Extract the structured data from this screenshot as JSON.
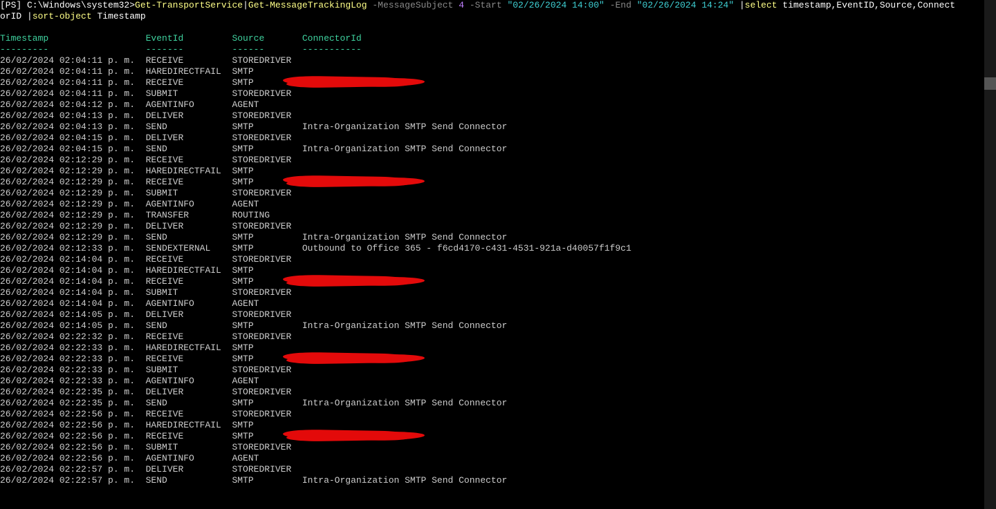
{
  "prompt": {
    "ps_label": "[PS]",
    "path": "C:\\Windows\\system32>",
    "cmd1": "Get-TransportService",
    "pipe1": "|",
    "cmd2": "Get-MessageTrackingLog",
    "p_subject": "-MessageSubject",
    "v_subject": "4",
    "p_start": "-Start",
    "v_start": "\"02/26/2024 14:00\"",
    "p_end": "-End",
    "v_end": "\"02/26/2024 14:24\"",
    "pipe2": "|",
    "cmd3": "select",
    "sel_cols": "timestamp,EventID,Source,Connect",
    "wrap_line": "orID ",
    "pipe3": "|",
    "cmd4": "sort-object",
    "sort_col": "Timestamp"
  },
  "headers": {
    "h1": "Timestamp",
    "h2": "EventId",
    "h3": "Source",
    "h4": "ConnectorId",
    "u1": "---------",
    "u2": "-------",
    "u3": "------",
    "u4": "-----------"
  },
  "rows": [
    {
      "ts": "26/02/2024 02:04:11 p. m.",
      "ev": "RECEIVE",
      "src": "STOREDRIVER",
      "conn": ""
    },
    {
      "ts": "26/02/2024 02:04:11 p. m.",
      "ev": "HAREDIRECTFAIL",
      "src": "SMTP",
      "conn": ""
    },
    {
      "ts": "26/02/2024 02:04:11 p. m.",
      "ev": "RECEIVE",
      "src": "SMTP",
      "conn": "",
      "redacted": true
    },
    {
      "ts": "26/02/2024 02:04:11 p. m.",
      "ev": "SUBMIT",
      "src": "STOREDRIVER",
      "conn": ""
    },
    {
      "ts": "26/02/2024 02:04:12 p. m.",
      "ev": "AGENTINFO",
      "src": "AGENT",
      "conn": ""
    },
    {
      "ts": "26/02/2024 02:04:13 p. m.",
      "ev": "DELIVER",
      "src": "STOREDRIVER",
      "conn": ""
    },
    {
      "ts": "26/02/2024 02:04:13 p. m.",
      "ev": "SEND",
      "src": "SMTP",
      "conn": "Intra-Organization SMTP Send Connector"
    },
    {
      "ts": "26/02/2024 02:04:15 p. m.",
      "ev": "DELIVER",
      "src": "STOREDRIVER",
      "conn": ""
    },
    {
      "ts": "26/02/2024 02:04:15 p. m.",
      "ev": "SEND",
      "src": "SMTP",
      "conn": "Intra-Organization SMTP Send Connector"
    },
    {
      "ts": "26/02/2024 02:12:29 p. m.",
      "ev": "RECEIVE",
      "src": "STOREDRIVER",
      "conn": ""
    },
    {
      "ts": "26/02/2024 02:12:29 p. m.",
      "ev": "HAREDIRECTFAIL",
      "src": "SMTP",
      "conn": ""
    },
    {
      "ts": "26/02/2024 02:12:29 p. m.",
      "ev": "RECEIVE",
      "src": "SMTP",
      "conn": "",
      "redacted": true
    },
    {
      "ts": "26/02/2024 02:12:29 p. m.",
      "ev": "SUBMIT",
      "src": "STOREDRIVER",
      "conn": ""
    },
    {
      "ts": "26/02/2024 02:12:29 p. m.",
      "ev": "AGENTINFO",
      "src": "AGENT",
      "conn": ""
    },
    {
      "ts": "26/02/2024 02:12:29 p. m.",
      "ev": "TRANSFER",
      "src": "ROUTING",
      "conn": ""
    },
    {
      "ts": "26/02/2024 02:12:29 p. m.",
      "ev": "DELIVER",
      "src": "STOREDRIVER",
      "conn": ""
    },
    {
      "ts": "26/02/2024 02:12:29 p. m.",
      "ev": "SEND",
      "src": "SMTP",
      "conn": "Intra-Organization SMTP Send Connector"
    },
    {
      "ts": "26/02/2024 02:12:33 p. m.",
      "ev": "SENDEXTERNAL",
      "src": "SMTP",
      "conn": "Outbound to Office 365 - f6cd4170-c431-4531-921a-d40057f1f9c1"
    },
    {
      "ts": "26/02/2024 02:14:04 p. m.",
      "ev": "RECEIVE",
      "src": "STOREDRIVER",
      "conn": ""
    },
    {
      "ts": "26/02/2024 02:14:04 p. m.",
      "ev": "HAREDIRECTFAIL",
      "src": "SMTP",
      "conn": ""
    },
    {
      "ts": "26/02/2024 02:14:04 p. m.",
      "ev": "RECEIVE",
      "src": "SMTP",
      "conn": "",
      "redacted": true
    },
    {
      "ts": "26/02/2024 02:14:04 p. m.",
      "ev": "SUBMIT",
      "src": "STOREDRIVER",
      "conn": ""
    },
    {
      "ts": "26/02/2024 02:14:04 p. m.",
      "ev": "AGENTINFO",
      "src": "AGENT",
      "conn": ""
    },
    {
      "ts": "26/02/2024 02:14:05 p. m.",
      "ev": "DELIVER",
      "src": "STOREDRIVER",
      "conn": ""
    },
    {
      "ts": "26/02/2024 02:14:05 p. m.",
      "ev": "SEND",
      "src": "SMTP",
      "conn": "Intra-Organization SMTP Send Connector"
    },
    {
      "ts": "26/02/2024 02:22:32 p. m.",
      "ev": "RECEIVE",
      "src": "STOREDRIVER",
      "conn": ""
    },
    {
      "ts": "26/02/2024 02:22:33 p. m.",
      "ev": "HAREDIRECTFAIL",
      "src": "SMTP",
      "conn": ""
    },
    {
      "ts": "26/02/2024 02:22:33 p. m.",
      "ev": "RECEIVE",
      "src": "SMTP",
      "conn": "",
      "redacted": true
    },
    {
      "ts": "26/02/2024 02:22:33 p. m.",
      "ev": "SUBMIT",
      "src": "STOREDRIVER",
      "conn": ""
    },
    {
      "ts": "26/02/2024 02:22:33 p. m.",
      "ev": "AGENTINFO",
      "src": "AGENT",
      "conn": ""
    },
    {
      "ts": "26/02/2024 02:22:35 p. m.",
      "ev": "DELIVER",
      "src": "STOREDRIVER",
      "conn": ""
    },
    {
      "ts": "26/02/2024 02:22:35 p. m.",
      "ev": "SEND",
      "src": "SMTP",
      "conn": "Intra-Organization SMTP Send Connector"
    },
    {
      "ts": "26/02/2024 02:22:56 p. m.",
      "ev": "RECEIVE",
      "src": "STOREDRIVER",
      "conn": ""
    },
    {
      "ts": "26/02/2024 02:22:56 p. m.",
      "ev": "HAREDIRECTFAIL",
      "src": "SMTP",
      "conn": ""
    },
    {
      "ts": "26/02/2024 02:22:56 p. m.",
      "ev": "RECEIVE",
      "src": "SMTP",
      "conn": "",
      "redacted": true
    },
    {
      "ts": "26/02/2024 02:22:56 p. m.",
      "ev": "SUBMIT",
      "src": "STOREDRIVER",
      "conn": ""
    },
    {
      "ts": "26/02/2024 02:22:56 p. m.",
      "ev": "AGENTINFO",
      "src": "AGENT",
      "conn": ""
    },
    {
      "ts": "26/02/2024 02:22:57 p. m.",
      "ev": "DELIVER",
      "src": "STOREDRIVER",
      "conn": ""
    },
    {
      "ts": "26/02/2024 02:22:57 p. m.",
      "ev": "SEND",
      "src": "SMTP",
      "conn": "Intra-Organization SMTP Send Connector"
    }
  ],
  "columns": {
    "ts_w": 27,
    "ev_w": 16,
    "src_w": 13
  }
}
